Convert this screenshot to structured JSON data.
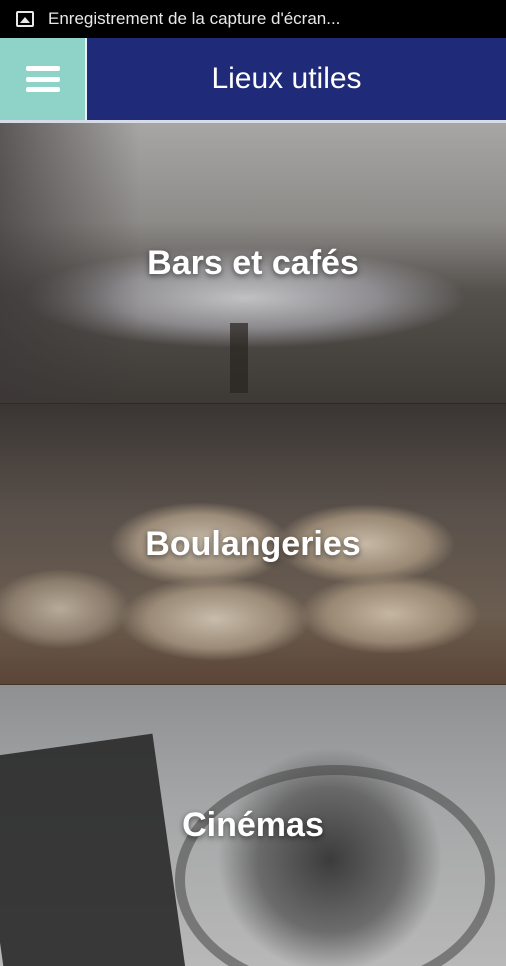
{
  "status_bar": {
    "notification_icon": "image-icon",
    "notification_text": "Enregistrement de la capture d'écran..."
  },
  "app_bar": {
    "menu_icon": "hamburger-menu-icon",
    "title": "Lieux utiles",
    "colors": {
      "menu_bg": "#8fd3c8",
      "title_bg": "#1f2a78"
    }
  },
  "categories": [
    {
      "label": "Bars et cafés"
    },
    {
      "label": "Boulangeries"
    },
    {
      "label": "Cinémas"
    }
  ]
}
